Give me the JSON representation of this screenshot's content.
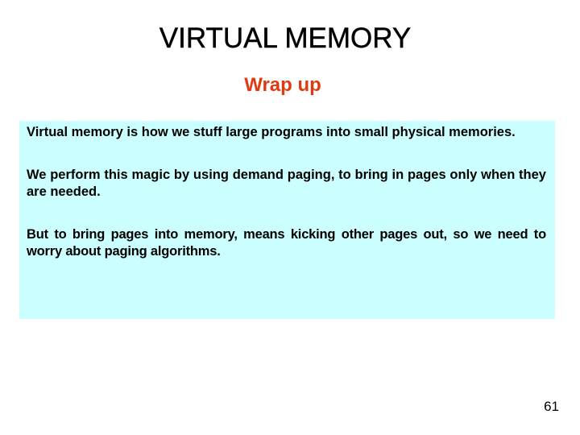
{
  "slide": {
    "title": "VIRTUAL MEMORY",
    "subtitle": "Wrap up",
    "paragraphs": [
      "Virtual memory is how we stuff large programs into small physical memories.",
      "We perform this magic by using demand paging, to bring in pages only when they are needed.",
      "But to bring pages into memory, means kicking other pages out, so we need to worry about paging algorithms."
    ],
    "page_number": "61"
  },
  "colors": {
    "subtitle": "#e03a10",
    "content_background": "#ccffff",
    "text": "#000000"
  }
}
